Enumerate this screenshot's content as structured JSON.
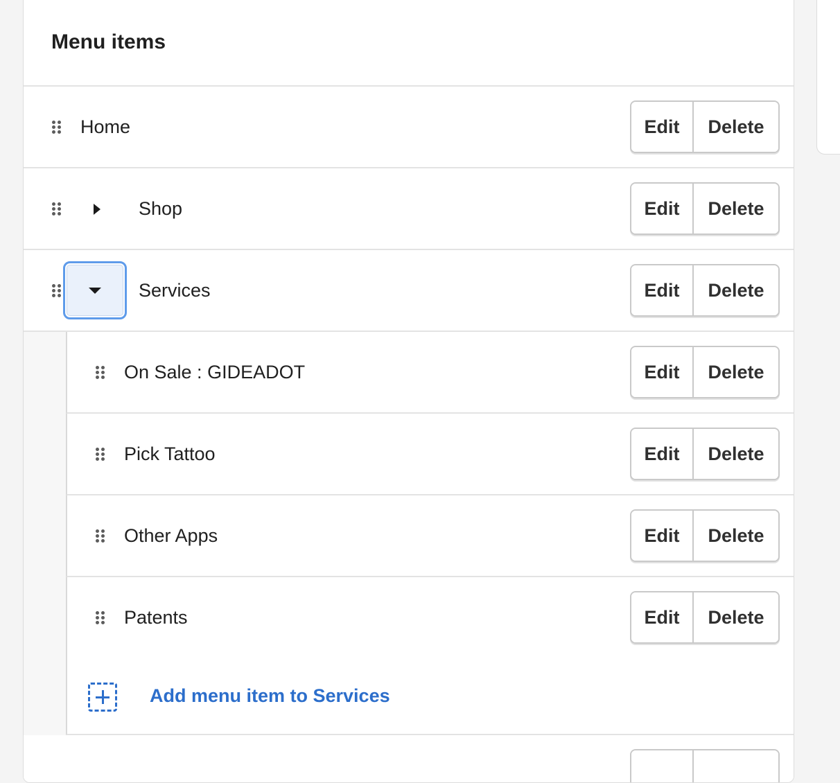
{
  "menu": {
    "title": "Menu items",
    "edit_label": "Edit",
    "delete_label": "Delete",
    "items": [
      {
        "label": "Home",
        "has_children": false
      },
      {
        "label": "Shop",
        "has_children": true,
        "expanded": false
      },
      {
        "label": "Services",
        "has_children": true,
        "expanded": true,
        "children": [
          {
            "label": "On Sale : GIDEADOT"
          },
          {
            "label": "Pick Tattoo"
          },
          {
            "label": "Other Apps"
          },
          {
            "label": "Patents"
          }
        ],
        "add_label": "Add menu item to Services"
      }
    ]
  },
  "colors": {
    "link": "#2c6ecb",
    "focus_ring": "#5e9bea",
    "text": "#202020",
    "page_bg": "#f4f4f4"
  }
}
